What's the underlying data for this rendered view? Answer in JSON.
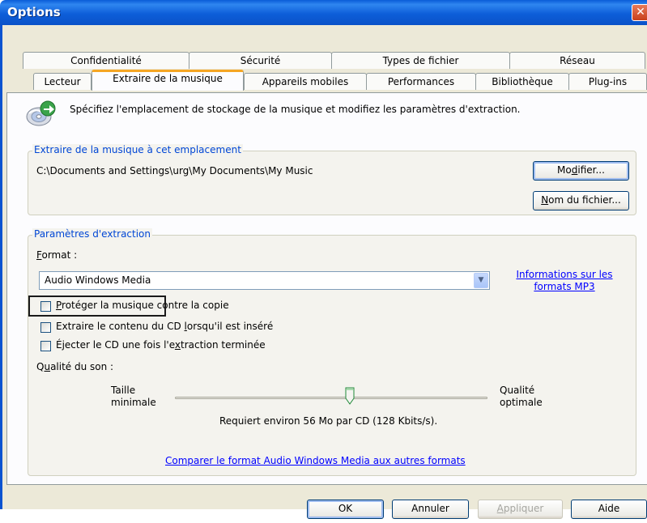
{
  "window": {
    "title": "Options",
    "close_glyph": "✕"
  },
  "tabs_row1": [
    "Confidentialité",
    "Sécurité",
    "Types de fichier",
    "Réseau"
  ],
  "tabs_row2": [
    "Lecteur",
    "Extraire de la musique",
    "Appareils mobiles",
    "Performances",
    "Bibliothèque",
    "Plug-ins"
  ],
  "active_tab": "Extraire de la musique",
  "header": {
    "icon": "cd-rip-icon",
    "description": "Spécifiez l'emplacement de stockage de la musique et modifiez les paramètres d'extraction."
  },
  "location": {
    "legend": "Extraire de la musique à cet emplacement",
    "path": "C:\\Documents and Settings\\urg\\My Documents\\My Music",
    "modify_pre": "Mo",
    "modify_ul": "d",
    "modify_post": "ifier...",
    "filename_pre": "",
    "filename_ul": "N",
    "filename_post": "om du fichier..."
  },
  "extraction": {
    "legend": "Paramètres d'extraction",
    "format_label_ul": "F",
    "format_label_rest": "ormat :",
    "format_value": "Audio Windows Media",
    "format_link_line1": "Informations sur les",
    "format_link_line2": "formats MP3",
    "checkbox_protect_ul": "P",
    "checkbox_protect_rest": "rotéger la musique contre la copie",
    "checkbox_autorip_pre": "Extraire le contenu du CD ",
    "checkbox_autorip_ul": "l",
    "checkbox_autorip_post": "orsqu'il est inséré",
    "checkbox_eject_pre": "Éjecter le CD une fois l'e",
    "checkbox_eject_ul": "x",
    "checkbox_eject_post": "traction terminée",
    "checkbox_protect_checked": false,
    "checkbox_autorip_checked": false,
    "checkbox_eject_checked": false,
    "quality_label_pre": "Q",
    "quality_label_ul": "u",
    "quality_label_post": "alité du son :",
    "quality_min_line1": "Taille",
    "quality_min_line2": "minimale",
    "quality_max_line1": "Qualité",
    "quality_max_line2": "optimale",
    "quality_level": 0.56,
    "quality_info": "Requiert environ 56 Mo par CD (128 Kbits/s).",
    "compare_link": "Comparer le format Audio Windows Media aux autres formats"
  },
  "buttons": {
    "ok": "OK",
    "cancel": "Annuler",
    "apply_ul": "A",
    "apply_rest": "ppliquer",
    "help": "Aide"
  },
  "colors": {
    "title_bar": "#0a5cd8",
    "active_tab_accent": "#f5a623",
    "legend_text": "#0046d5",
    "link": "#0000ff"
  }
}
